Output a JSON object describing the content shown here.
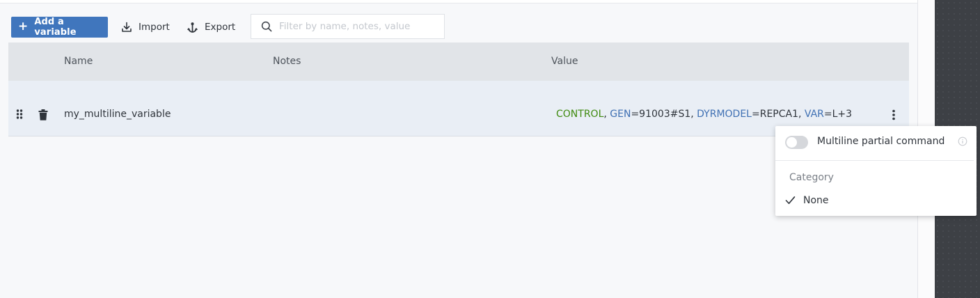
{
  "toolbar": {
    "add_label": "Add a variable",
    "import_label": "Import",
    "export_label": "Export",
    "search_placeholder": "Filter by name, notes, value"
  },
  "table": {
    "headers": [
      "Name",
      "Notes",
      "Value"
    ],
    "rows": [
      {
        "name": "my_multiline_variable",
        "notes": "",
        "value": {
          "control": "CONTROL",
          "sep1": ", ",
          "gen_key": "GEN",
          "gen_val": "=91003#S1, ",
          "dyr_key": "DYRMODEL",
          "dyr_val": "=REPCA1, ",
          "var_key": "VAR",
          "var_val": "=L+3"
        }
      }
    ]
  },
  "menu": {
    "multiline_label": "Multiline partial command",
    "multiline_enabled": false,
    "category_heading": "Category",
    "category_selected": "None"
  },
  "colors": {
    "accent": "#4076bd",
    "control_keyword": "#3f8a0f",
    "param_keyword": "#3f70b3"
  },
  "icons": [
    "plus-icon",
    "import-icon",
    "export-icon",
    "search-icon",
    "drag-handle-icon",
    "trash-icon",
    "kebab-menu-icon",
    "info-icon",
    "check-icon"
  ]
}
